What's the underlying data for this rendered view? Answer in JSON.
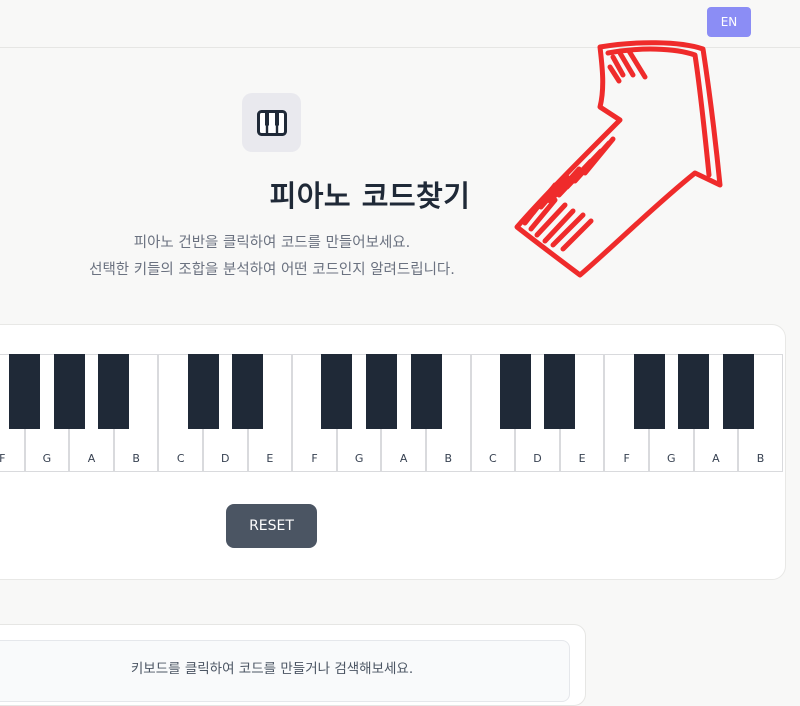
{
  "header": {
    "language_button": "EN"
  },
  "hero": {
    "icon": "piano-icon",
    "title": "피아노 코드찾기",
    "subtitle_line1": "피아노 건반을 클릭하여 코드를 만들어보세요.",
    "subtitle_line2": "선택한 키들의 조합을 분석하여 어떤 코드인지 알려드립니다."
  },
  "keyboard": {
    "white_keys": [
      "F",
      "G",
      "A",
      "B",
      "C",
      "D",
      "E",
      "F",
      "G",
      "A",
      "B",
      "C",
      "D",
      "E",
      "F",
      "G",
      "A",
      "B"
    ],
    "black_keys_count": 13
  },
  "controls": {
    "reset_label": "RESET"
  },
  "search": {
    "hint": "키보드를 클릭하여 코드를 만들거나 검색해보세요."
  },
  "annotation": {
    "arrow_color": "#ef2b2b",
    "icon": "arrow-annotation"
  },
  "colors": {
    "accent": "#8b8df5",
    "black_key": "#1f2937",
    "reset_button": "#4b5563"
  }
}
